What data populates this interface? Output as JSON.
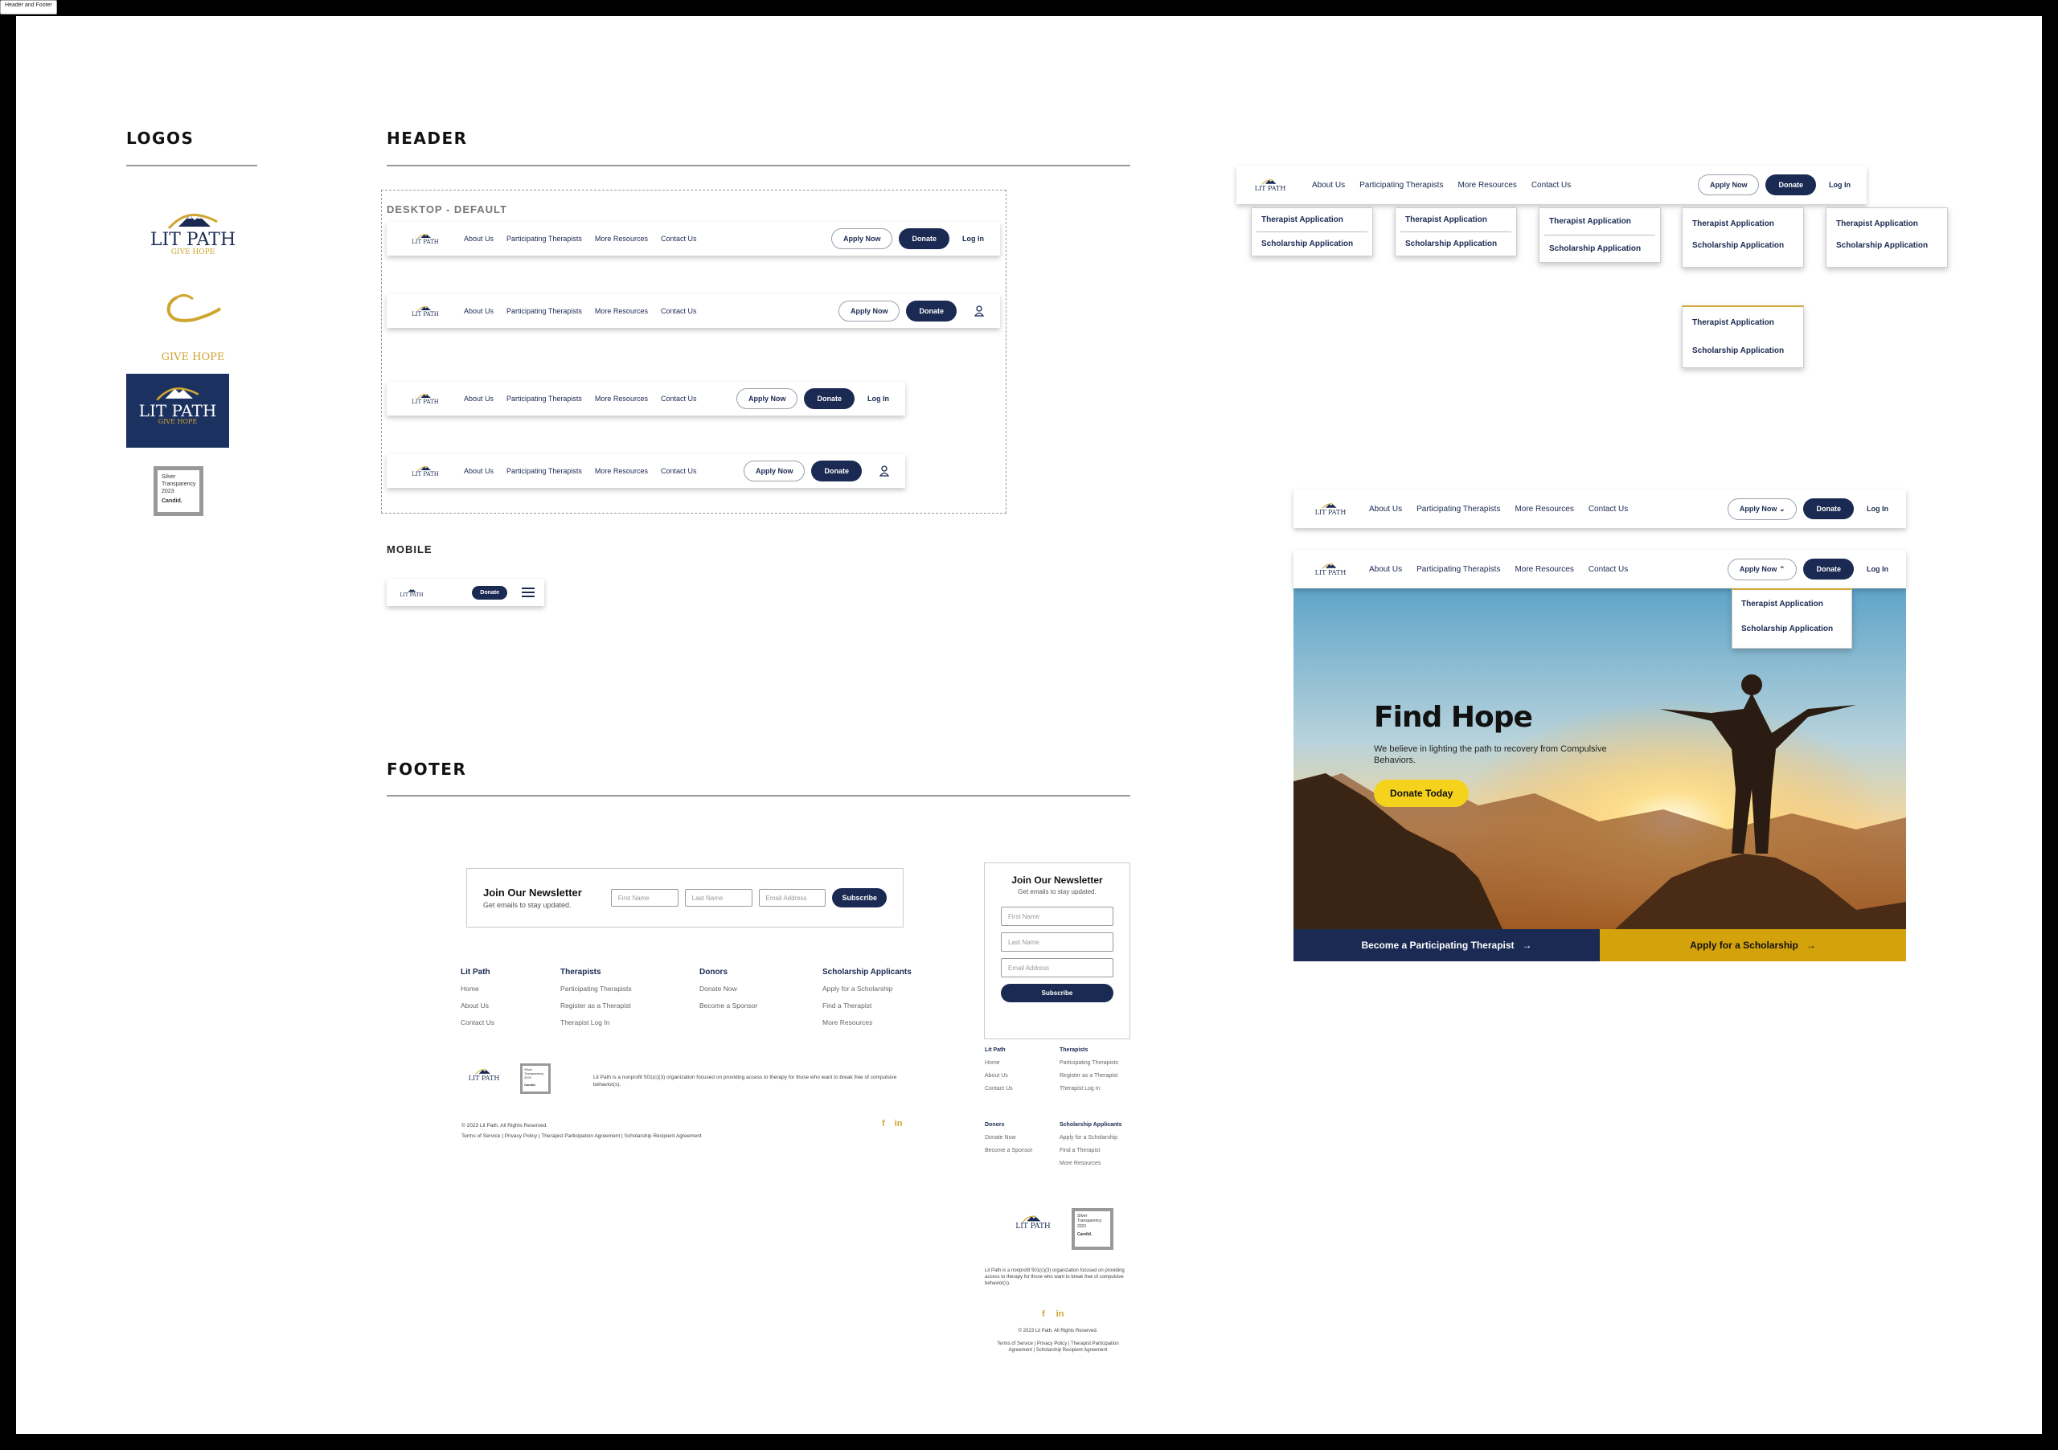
{
  "frame_tag": "Header and Footer",
  "brand": {
    "navy": "#1b2a52",
    "gold": "#cfa52f",
    "yellow": "#f5d21c",
    "mustard": "#d4a30c"
  },
  "logo": {
    "name": "LIT PATH",
    "tagline": "GIVE HOPE"
  },
  "candid_badge": {
    "lines": [
      "Silver",
      "Transparency",
      "2023"
    ],
    "brand": "Candid."
  },
  "sections": {
    "logos": "LOGOS",
    "header": "HEADER",
    "desktop_default": "DESKTOP - DEFAULT",
    "mobile": "MOBILE",
    "footer": "FOOTER"
  },
  "nav": {
    "about": "About Us",
    "therapists": "Participating Therapists",
    "resources": "More Resources",
    "contact": "Contact Us",
    "apply": "Apply Now",
    "donate": "Donate",
    "login": "Log In"
  },
  "dropdown": {
    "therapist_app": "Therapist Application",
    "scholarship_app": "Scholarship Application"
  },
  "hero": {
    "title": "Find Hope",
    "text": "We believe in lighting the path to recovery from Compulsive Behaviors.",
    "cta": "Donate Today",
    "band_left": "Become a Participating Therapist",
    "band_right": "Apply for a Scholarship"
  },
  "newsletter": {
    "title": "Join Our Newsletter",
    "subtitle": "Get emails to stay updated.",
    "first_name": "First Name",
    "last_name": "Last Name",
    "email": "Email Address",
    "subscribe": "Subscribe"
  },
  "footer_cols": {
    "litpath": {
      "title": "Lit Path",
      "links": [
        "Home",
        "About Us",
        "Contact Us"
      ]
    },
    "therapists": {
      "title": "Therapists",
      "links": [
        "Participating Therapists",
        "Register as a Therapist",
        "Therapist Log In"
      ]
    },
    "donors": {
      "title": "Donors",
      "links": [
        "Donate Now",
        "Become a Sponsor"
      ]
    },
    "scholarship": {
      "title": "Scholarship Applicants",
      "links": [
        "Apply for a Scholarship",
        "Find a Therapist",
        "More Resources"
      ]
    }
  },
  "footer": {
    "mission": "Lit Path is a nonprofit 501(c)(3) organization focused on providing access to therapy for those who want to break free of compulsive behavior(s).",
    "copyright": "© 2023 Lit Path. All Rights Reserved.",
    "legal": "Terms of Service | Privacy Policy | Therapist Participation Agreement | Scholarship Recipient Agreement",
    "social": [
      "facebook-icon",
      "linkedin-icon"
    ]
  }
}
